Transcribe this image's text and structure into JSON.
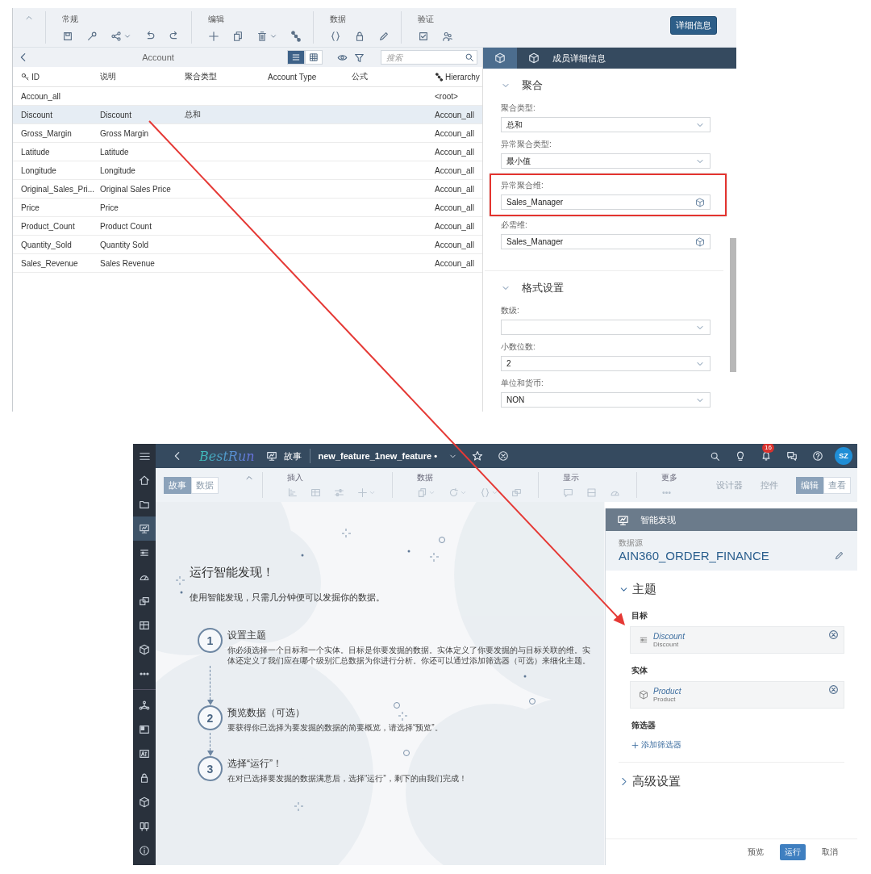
{
  "model_editor": {
    "toolbar": {
      "groups": [
        {
          "label": "常规"
        },
        {
          "label": "编辑"
        },
        {
          "label": "数据"
        },
        {
          "label": "验证"
        }
      ],
      "details_button": "详细信息"
    },
    "table": {
      "title": "Account",
      "view_toggle": [
        {
          "selected": true
        },
        {
          "selected": false
        }
      ],
      "search": {
        "placeholder": "搜索"
      },
      "columns": [
        "ID",
        "说明",
        "聚合类型",
        "Account Type",
        "公式",
        "Hierarchy"
      ],
      "rows": [
        {
          "id": "Accoun_all",
          "hierarchy": "<root>",
          "selected": false
        },
        {
          "id": "Discount",
          "description": "Discount",
          "aggregation_type": "总和",
          "hierarchy": "Accoun_all",
          "selected": true
        },
        {
          "id": "Gross_Margin",
          "description": "Gross Margin",
          "hierarchy": "Accoun_all",
          "selected": false
        },
        {
          "id": "Latitude",
          "description": "Latitude",
          "hierarchy": "Accoun_all",
          "selected": false
        },
        {
          "id": "Longitude",
          "description": "Longitude",
          "hierarchy": "Accoun_all",
          "selected": false
        },
        {
          "id": "Original_Sales_Pri...",
          "description": "Original Sales Price",
          "hierarchy": "Accoun_all",
          "selected": false
        },
        {
          "id": "Price",
          "description": "Price",
          "hierarchy": "Accoun_all",
          "selected": false
        },
        {
          "id": "Product_Count",
          "description": "Product Count",
          "hierarchy": "Accoun_all",
          "selected": false
        },
        {
          "id": "Quantity_Sold",
          "description": "Quantity Sold",
          "hierarchy": "Accoun_all",
          "selected": false
        },
        {
          "id": "Sales_Revenue",
          "description": "Sales Revenue",
          "hierarchy": "Accoun_all",
          "selected": false
        }
      ]
    },
    "details_panel": {
      "tabs": [
        {
          "selected": true
        },
        {
          "label": "成员详细信息",
          "selected": false
        }
      ],
      "sections": [
        {
          "title": "聚合",
          "expanded": true,
          "fields": [
            {
              "label": "聚合类型:",
              "value": "总和",
              "kind": "dropdown",
              "highlighted": false
            },
            {
              "label": "异常聚合类型:",
              "value": "最小值",
              "kind": "dropdown",
              "highlighted": false
            },
            {
              "label": "异常聚合维:",
              "value": "Sales_Manager",
              "kind": "dimension",
              "highlighted": true
            },
            {
              "label": "必需维:",
              "value": "Sales_Manager",
              "kind": "dimension",
              "highlighted": false
            }
          ]
        },
        {
          "title": "格式设置",
          "expanded": true,
          "fields": [
            {
              "label": "数级:",
              "kind": "dropdown",
              "highlighted": false
            },
            {
              "label": "小数位数:",
              "value": "2",
              "kind": "dropdown",
              "highlighted": false
            },
            {
              "label": "单位和货币:",
              "value": "NON",
              "kind": "dropdown",
              "highlighted": false
            }
          ]
        }
      ]
    }
  },
  "story_app": {
    "shell": {
      "logo": "BestRun",
      "breadcrumb": "故事",
      "file_title": "new_feature_1new_feature •",
      "notification_count": "16",
      "avatar": "SZ"
    },
    "sidebar": {
      "groups": [
        [
          {
            "selected": false
          },
          {
            "selected": false
          },
          {
            "selected": true
          },
          {
            "selected": false
          },
          {
            "selected": false
          },
          {
            "selected": false
          },
          {
            "selected": false
          },
          {
            "selected": false
          },
          {
            "selected": false
          }
        ],
        [
          {
            "selected": false
          },
          {
            "selected": false
          },
          {
            "selected": false
          },
          {
            "selected": false
          },
          {
            "selected": false
          },
          {
            "selected": false
          },
          {
            "selected": false
          }
        ]
      ]
    },
    "toolbar": {
      "mode_toggle": [
        {
          "label": "故事",
          "selected": true
        },
        {
          "label": "数据",
          "selected": false
        }
      ],
      "groups": [
        {
          "label": "插入"
        },
        {
          "label": "数据"
        },
        {
          "label": "显示"
        },
        {
          "label": "更多"
        }
      ],
      "links": [
        "设计器",
        "控件"
      ],
      "view_toggle": [
        {
          "label": "编辑",
          "selected": true
        },
        {
          "label": "查看",
          "selected": false
        }
      ]
    },
    "canvas": {
      "title": "运行智能发现！",
      "subtitle": "使用智能发现，只需几分钟便可以发掘你的数据。",
      "steps": [
        {
          "number": "1",
          "title": "设置主题",
          "text": "你必须选择一个目标和一个实体。目标是你要发掘的数据。实体定义了你要发掘的与目标关联的维。实体还定义了我们应在哪个级别汇总数据为你进行分析。你还可以通过添加筛选器（可选）来细化主题。"
        },
        {
          "number": "2",
          "title": "预览数据（可选）",
          "text": "要获得你已选择为要发掘的数据的简要概览，请选择“预览”。"
        },
        {
          "number": "3",
          "title": "选择“运行”！",
          "text": "在对已选择要发掘的数据满意后，选择“运行”，剩下的由我们完成！"
        }
      ]
    },
    "panel": {
      "title": "智能发现",
      "datasource_label": "数据源",
      "datasource": "AIN360_ORDER_FINANCE",
      "topic": {
        "title": "主题",
        "expanded": true,
        "target_label": "目标",
        "target": {
          "name": "Discount",
          "description": "Discount"
        },
        "entity_label": "实体",
        "entity": {
          "name": "Product",
          "description": "Product"
        },
        "filter_label": "筛选器",
        "add_filter": "添加筛选器"
      },
      "advanced": {
        "title": "高级设置",
        "expanded": false
      },
      "footer_buttons": [
        {
          "label": "预览",
          "kind": "plain"
        },
        {
          "label": "运行",
          "kind": "primary"
        },
        {
          "label": "取消",
          "kind": "plain"
        }
      ]
    }
  },
  "annotation": {
    "arrow": true
  }
}
